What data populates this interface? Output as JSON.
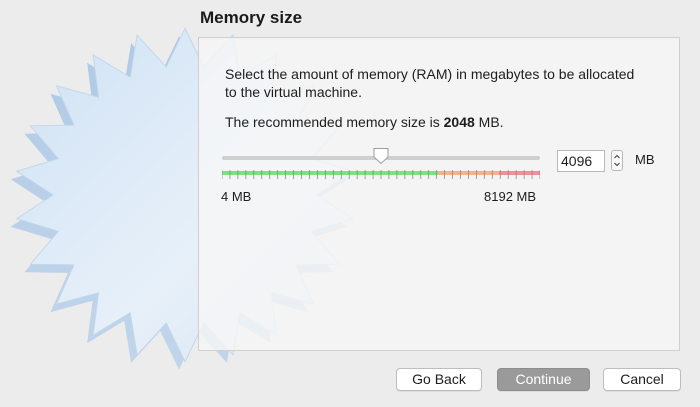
{
  "page": {
    "title": "Memory size",
    "description": "Select the amount of memory (RAM) in megabytes to be allocated to the virtual machine.",
    "recommended_prefix": "The recommended memory size is ",
    "recommended_value": "2048",
    "recommended_suffix": " MB."
  },
  "memory": {
    "value": "4096",
    "min": 4,
    "max": 8192,
    "min_label": "4 MB",
    "max_label": "8192 MB",
    "unit": "MB",
    "zones": {
      "green_end_fraction": 0.68,
      "orange_end_fraction": 0.87,
      "green_color": "#7fe07f",
      "orange_color": "#f5b08e",
      "red_color": "#f08f95"
    }
  },
  "buttons": {
    "back": "Go Back",
    "continue": "Continue",
    "cancel": "Cancel"
  },
  "icons": {
    "wizard_art": "starburst-wizard-art",
    "stepper": "up-down-stepper-icon"
  }
}
